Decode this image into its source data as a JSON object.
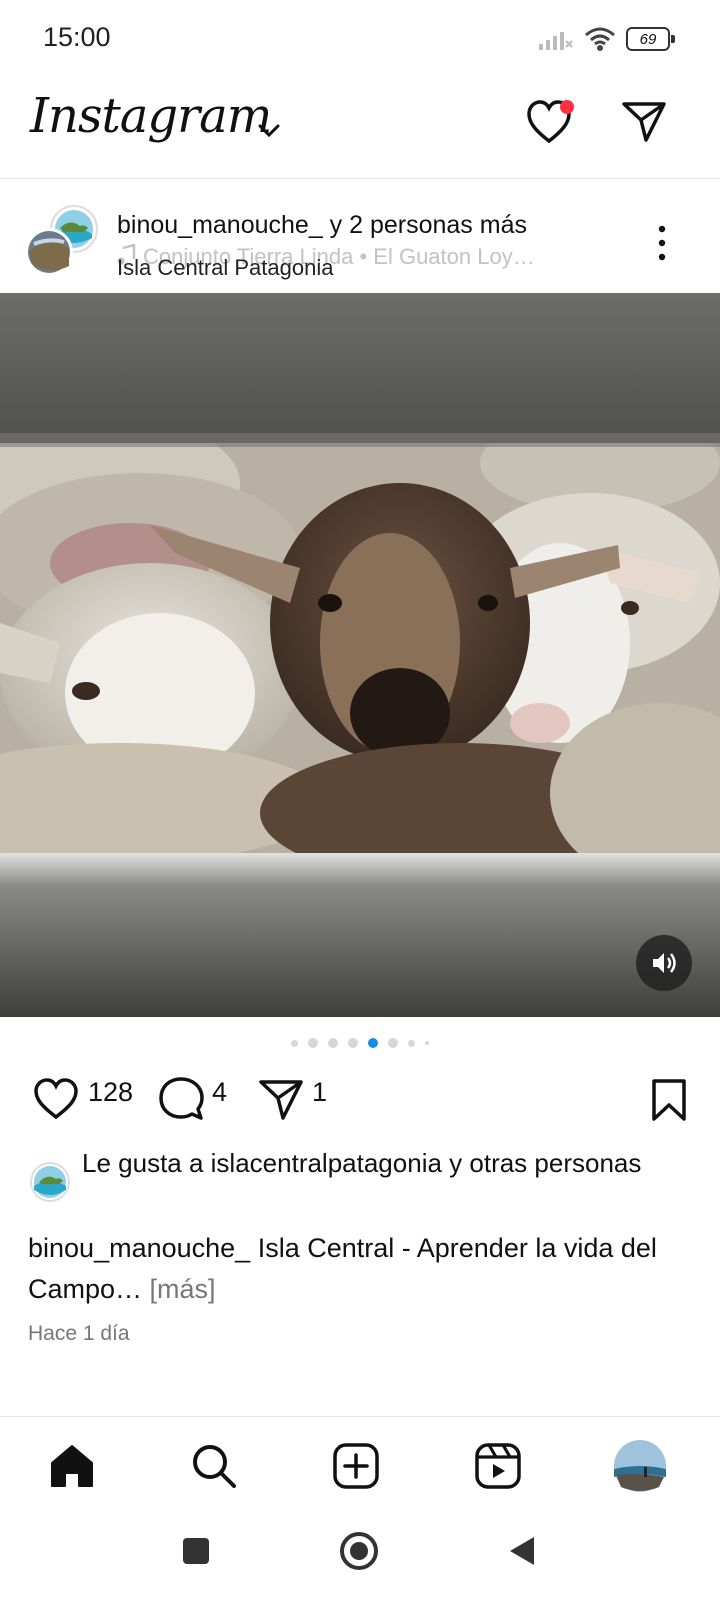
{
  "status_bar": {
    "time": "15:00",
    "battery": "69"
  },
  "header": {
    "logo": "Instagram"
  },
  "post": {
    "collab_line": "binou_manouche_ y 2 personas más",
    "music": "Conjunto Tierra Linda  •  El Guaton Loy…",
    "location": "Isla Central Patagonia",
    "carousel": {
      "total": 8,
      "active_index": 4
    },
    "likes": "128",
    "comments": "4",
    "shares": "1",
    "liked_by": {
      "prefix": "Le gusta a ",
      "user": "islacentralpatagonia",
      "suffix": " y otras personas"
    },
    "caption": {
      "user": "binou_manouche_",
      "text": " Isla Central - Aprender la vida del Campo…",
      "more": " [más]"
    },
    "time_ago": "Hace 1 día"
  },
  "colors": {
    "accent": "#1a8ce6",
    "notification": "#ff3040"
  }
}
